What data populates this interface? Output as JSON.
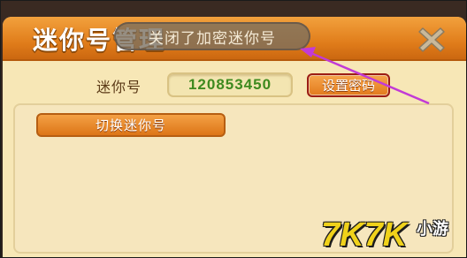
{
  "dialog": {
    "title": "迷你号管理"
  },
  "tooltip": {
    "text": "关闭了加密迷你号"
  },
  "account": {
    "label": "迷你号",
    "id_value": "120853450",
    "set_password_label": "设置密码"
  },
  "actions": {
    "switch_label": "切换迷你号"
  },
  "watermark": {
    "brand": "7K7K",
    "suffix": "小游"
  },
  "icons": {
    "close": "close-x-icon",
    "arrow": "annotation-arrow"
  },
  "colors": {
    "title_bar": "#e07c1a",
    "panel": "#f7e7b6",
    "id_text": "#3f8a1f",
    "button_border_red": "#9c1d14",
    "arrow": "#c23ad6"
  }
}
